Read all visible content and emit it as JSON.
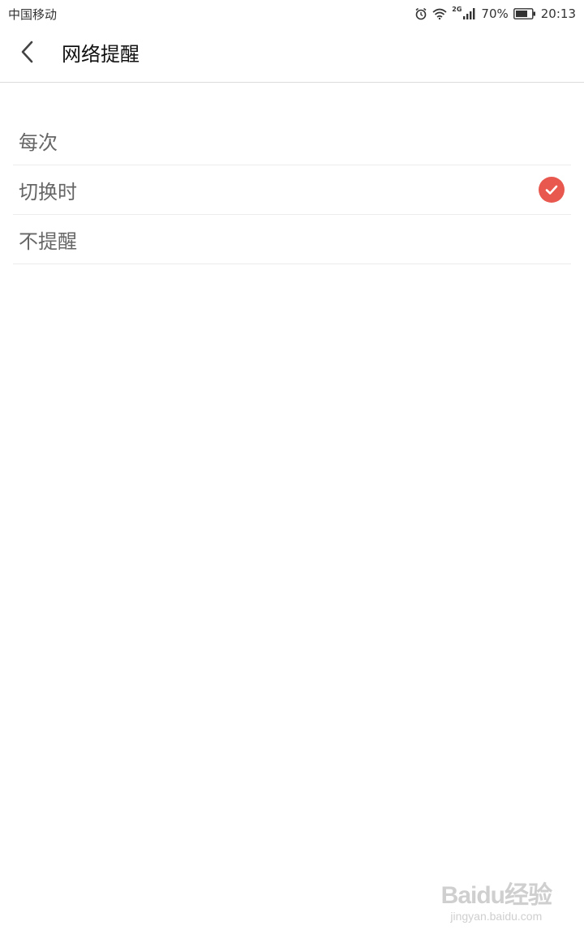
{
  "status_bar": {
    "carrier": "中国移动",
    "network_type": "2G",
    "battery": "70%",
    "time": "20:13"
  },
  "header": {
    "title": "网络提醒"
  },
  "options": [
    {
      "label": "每次",
      "selected": false
    },
    {
      "label": "切换时",
      "selected": true
    },
    {
      "label": "不提醒",
      "selected": false
    }
  ],
  "colors": {
    "accent": "#e8584f"
  },
  "watermark": {
    "logo": "Baidu经验",
    "url": "jingyan.baidu.com"
  }
}
